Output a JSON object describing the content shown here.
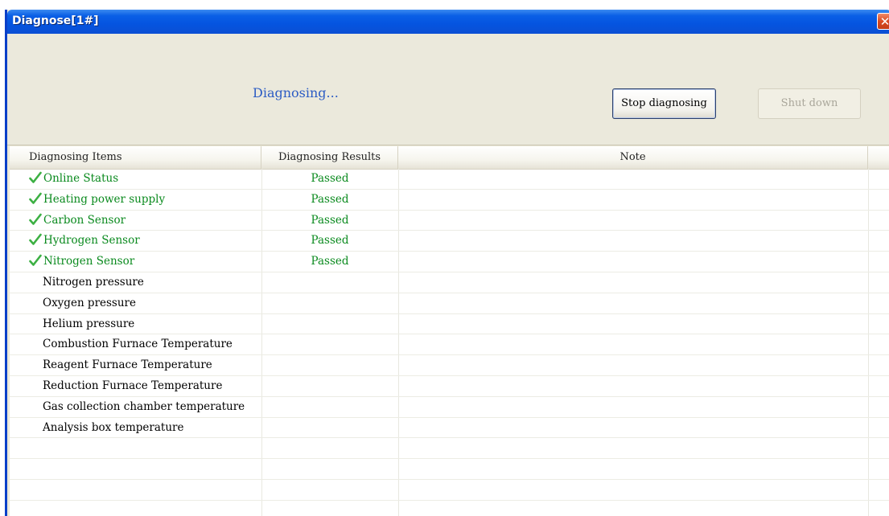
{
  "window": {
    "title": "Diagnose[1#]",
    "close_glyph": "✕"
  },
  "toolbar": {
    "status_text": "Diagnosing...",
    "stop_label": "Stop diagnosing",
    "shutdown_label": "Shut down",
    "shutdown_enabled": false
  },
  "grid": {
    "columns": [
      "Diagnosing Items",
      "Diagnosing Results",
      "Note"
    ],
    "rows": [
      {
        "item": "Online Status",
        "result": "Passed",
        "note": "",
        "passed": true
      },
      {
        "item": "Heating power supply",
        "result": "Passed",
        "note": "",
        "passed": true
      },
      {
        "item": "Carbon Sensor",
        "result": "Passed",
        "note": "",
        "passed": true
      },
      {
        "item": "Hydrogen Sensor",
        "result": "Passed",
        "note": "",
        "passed": true
      },
      {
        "item": "Nitrogen Sensor",
        "result": "Passed",
        "note": "",
        "passed": true
      },
      {
        "item": "Nitrogen pressure",
        "result": "",
        "note": "",
        "passed": false
      },
      {
        "item": "Oxygen pressure",
        "result": "",
        "note": "",
        "passed": false
      },
      {
        "item": "Helium pressure",
        "result": "",
        "note": "",
        "passed": false
      },
      {
        "item": "Combustion Furnace Temperature",
        "result": "",
        "note": "",
        "passed": false
      },
      {
        "item": "Reagent Furnace Temperature",
        "result": "",
        "note": "",
        "passed": false
      },
      {
        "item": "Reduction Furnace Temperature",
        "result": "",
        "note": "",
        "passed": false
      },
      {
        "item": "Gas collection chamber temperature",
        "result": "",
        "note": "",
        "passed": false
      },
      {
        "item": "Analysis box temperature",
        "result": "",
        "note": "",
        "passed": false
      },
      {
        "item": "",
        "result": "",
        "note": "",
        "passed": false
      },
      {
        "item": "",
        "result": "",
        "note": "",
        "passed": false
      },
      {
        "item": "",
        "result": "",
        "note": "",
        "passed": false
      },
      {
        "item": "",
        "result": "",
        "note": "",
        "passed": false
      }
    ]
  },
  "colors": {
    "titlebar": "#0554e0",
    "passed_text": "#0a8a1e",
    "status_text": "#2c5cc4",
    "check_icon": "#3cb043"
  },
  "icons": {
    "passed": "check-icon",
    "close": "close-icon"
  }
}
